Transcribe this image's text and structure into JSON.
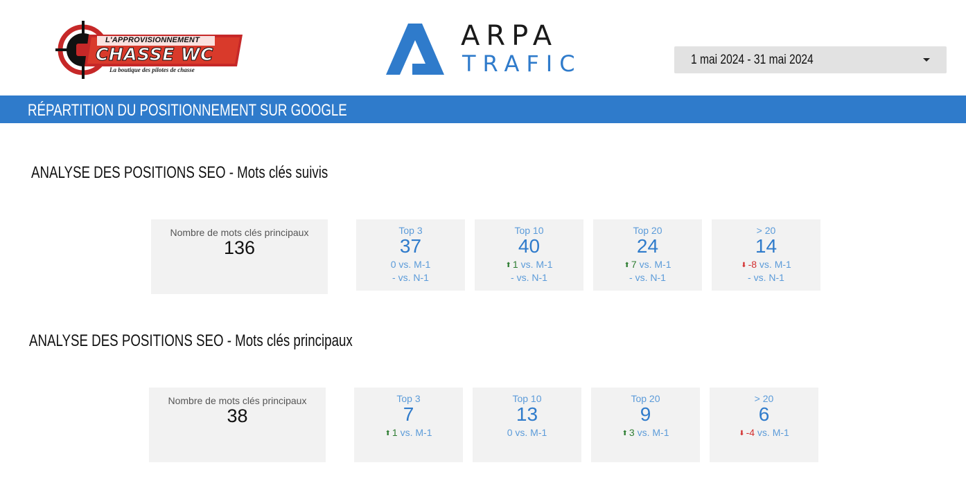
{
  "header": {
    "client_logo": {
      "top_text": "L'APPROVISIONNEMENT",
      "main_text": "CHASSE WC",
      "tagline": "La boutique des pilotes de chasse",
      "colors": {
        "red": "#c62828",
        "dark": "#111111"
      }
    },
    "agency_logo": {
      "line1": "ARPA",
      "line2": "TRAFIC",
      "accent": "#2f7bcb"
    },
    "date_range": {
      "label": "1 mai 2024 - 31 mai 2024",
      "icon": "caret-down-icon"
    }
  },
  "banner": {
    "title": "RÉPARTITION DU POSITIONNEMENT SUR GOOGLE",
    "color": "#2f7bcb"
  },
  "sections": [
    {
      "title": "ANALYSE DES POSITIONS SEO - Mots clés suivis",
      "total": {
        "label": "Nombre de mots clés principaux",
        "value": "136"
      },
      "metrics": [
        {
          "label": "Top 3",
          "value": "37",
          "m1_delta": "0",
          "m1_trend": "flat",
          "m1_suffix": "vs. M-1",
          "n1_delta": "-",
          "n1_suffix": "vs. N-1"
        },
        {
          "label": "Top 10",
          "value": "40",
          "m1_delta": "1",
          "m1_trend": "up",
          "m1_suffix": "vs. M-1",
          "n1_delta": "-",
          "n1_suffix": "vs. N-1"
        },
        {
          "label": "Top 20",
          "value": "24",
          "m1_delta": "7",
          "m1_trend": "up",
          "m1_suffix": "vs. M-1",
          "n1_delta": "-",
          "n1_suffix": "vs. N-1"
        },
        {
          "label": "> 20",
          "value": "14",
          "m1_delta": "-8",
          "m1_trend": "down",
          "m1_suffix": "vs. M-1",
          "n1_delta": "-",
          "n1_suffix": "vs. N-1"
        }
      ]
    },
    {
      "title": "ANALYSE DES POSITIONS SEO - Mots clés principaux",
      "total": {
        "label": "Nombre de mots clés principaux",
        "value": "38"
      },
      "metrics": [
        {
          "label": "Top 3",
          "value": "7",
          "m1_delta": "1",
          "m1_trend": "up",
          "m1_suffix": "vs. M-1"
        },
        {
          "label": "Top 10",
          "value": "13",
          "m1_delta": "0",
          "m1_trend": "flat",
          "m1_suffix": "vs. M-1"
        },
        {
          "label": "Top 20",
          "value": "9",
          "m1_delta": "3",
          "m1_trend": "up",
          "m1_suffix": "vs. M-1"
        },
        {
          "label": "> 20",
          "value": "6",
          "m1_delta": "-4",
          "m1_trend": "down",
          "m1_suffix": "vs. M-1"
        }
      ]
    }
  ],
  "colors": {
    "card_bg": "#f2f2f2",
    "metric_blue": "#2f7bcb",
    "trend_up": "#2e7d32",
    "trend_down": "#d32f2f"
  }
}
